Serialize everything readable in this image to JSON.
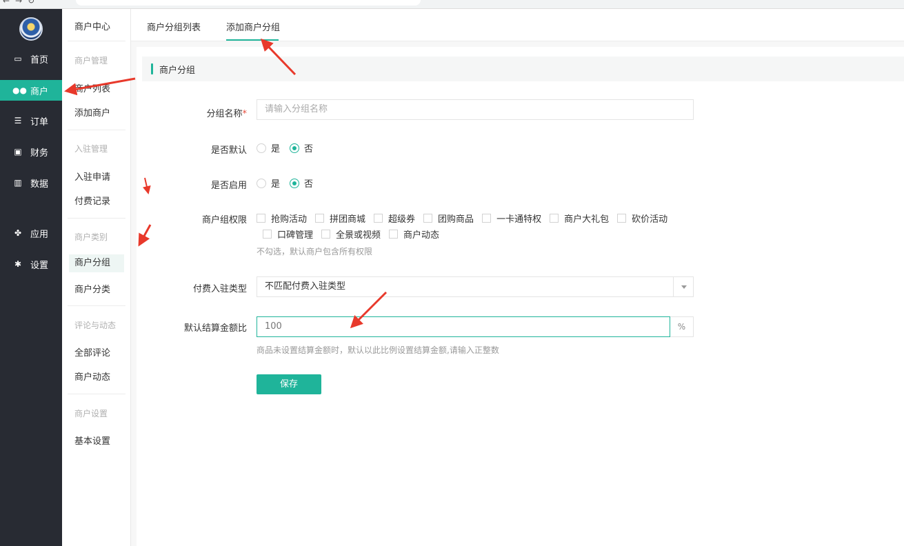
{
  "leftnav": {
    "items": [
      {
        "label": "首页",
        "icon": "monitor-icon"
      },
      {
        "label": "商户",
        "icon": "users-icon"
      },
      {
        "label": "订单",
        "icon": "list-icon"
      },
      {
        "label": "财务",
        "icon": "money-icon"
      },
      {
        "label": "数据",
        "icon": "chart-icon"
      },
      {
        "label": "应用",
        "icon": "apps-icon"
      },
      {
        "label": "设置",
        "icon": "gear-icon"
      }
    ],
    "active_color": "#1fb49a"
  },
  "submenu": {
    "title": "商户中心",
    "groups": [
      {
        "header": "商户管理",
        "items": [
          "商户列表",
          "添加商户"
        ]
      },
      {
        "header": "入驻管理",
        "items": [
          "入驻申请",
          "付费记录"
        ]
      },
      {
        "header": "商户类别",
        "items": [
          "商户分组",
          "商户分类"
        ]
      },
      {
        "header": "评论与动态",
        "items": [
          "全部评论",
          "商户动态"
        ]
      },
      {
        "header": "商户设置",
        "items": [
          "基本设置"
        ]
      }
    ]
  },
  "tabs": {
    "list": "商户分组列表",
    "add": "添加商户分组"
  },
  "form": {
    "section_title": "商户分组",
    "name": {
      "label": "分组名称",
      "required_mark": "*",
      "placeholder": "请输入分组名称"
    },
    "is_default": {
      "label": "是否默认",
      "yes": "是",
      "no": "否",
      "selected": "否"
    },
    "is_enabled": {
      "label": "是否启用",
      "yes": "是",
      "no": "否",
      "selected": "否"
    },
    "permissions": {
      "label": "商户组权限",
      "options": [
        "抢购活动",
        "拼团商城",
        "超级券",
        "团购商品",
        "一卡通特权",
        "商户大礼包",
        "砍价活动",
        "口碑管理",
        "全景或视频",
        "商户动态"
      ],
      "hint": "不勾选，默认商户包含所有权限"
    },
    "paid_type": {
      "label": "付费入驻类型",
      "value": "不匹配付费入驻类型"
    },
    "settle_ratio": {
      "label": "默认结算金额比",
      "value": "100",
      "unit": "%",
      "hint": "商品未设置结算金额时，默认以此比例设置结算金额,请输入正整数"
    },
    "save_label": "保存"
  }
}
